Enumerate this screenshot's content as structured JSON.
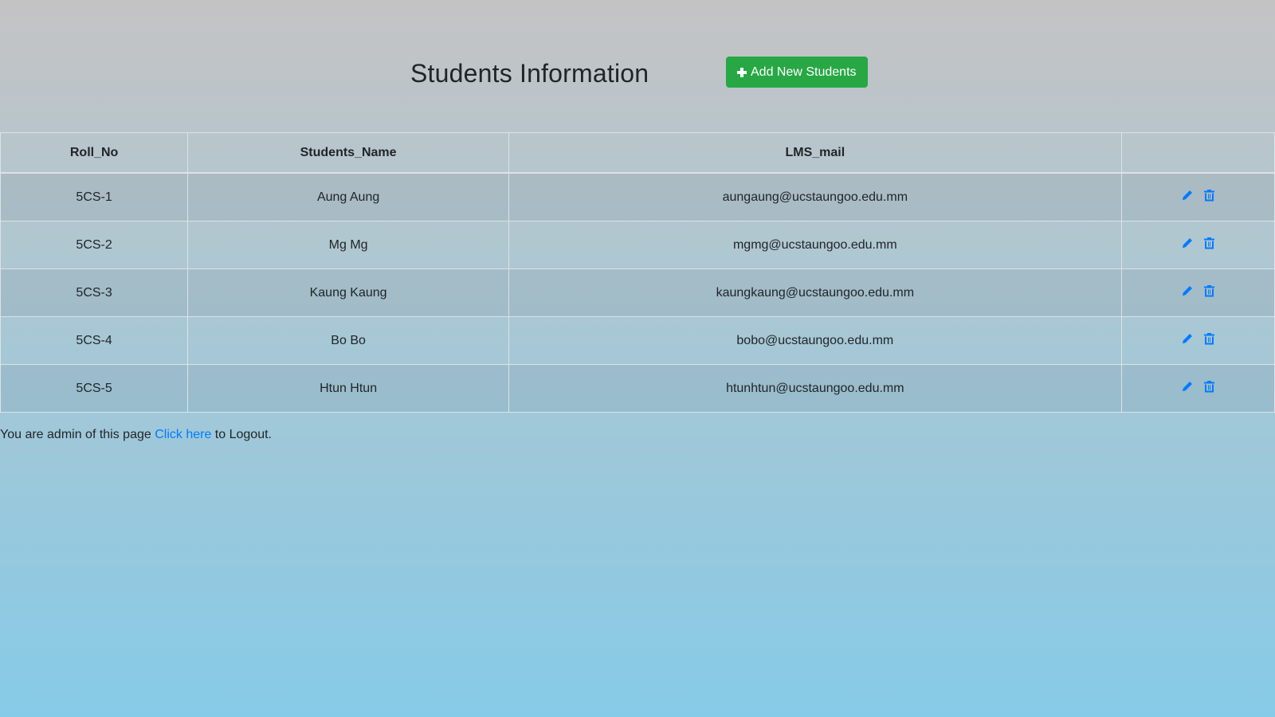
{
  "header": {
    "title": "Students Information",
    "add_button_label": "Add New Students",
    "add_button_icon": "plus-icon",
    "add_button_color": "#28a745"
  },
  "table": {
    "columns": [
      "Roll_No",
      "Students_Name",
      "LMS_mail",
      ""
    ],
    "rows": [
      {
        "roll_no": "5CS-1",
        "name": "Aung Aung",
        "mail": "aungaung@ucstaungoo.edu.mm"
      },
      {
        "roll_no": "5CS-2",
        "name": "Mg Mg",
        "mail": "mgmg@ucstaungoo.edu.mm"
      },
      {
        "roll_no": "5CS-3",
        "name": "Kaung Kaung",
        "mail": "kaungkaung@ucstaungoo.edu.mm"
      },
      {
        "roll_no": "5CS-4",
        "name": "Bo Bo",
        "mail": "bobo@ucstaungoo.edu.mm"
      },
      {
        "roll_no": "5CS-5",
        "name": "Htun Htun",
        "mail": "htunhtun@ucstaungoo.edu.mm"
      }
    ],
    "row_actions": [
      "pencil-icon",
      "trash-icon"
    ],
    "action_icon_color": "#007bff"
  },
  "footer": {
    "prefix": "You are admin of this page ",
    "link_text": "Click here",
    "suffix": " to Logout.",
    "link_color": "#007bff"
  }
}
